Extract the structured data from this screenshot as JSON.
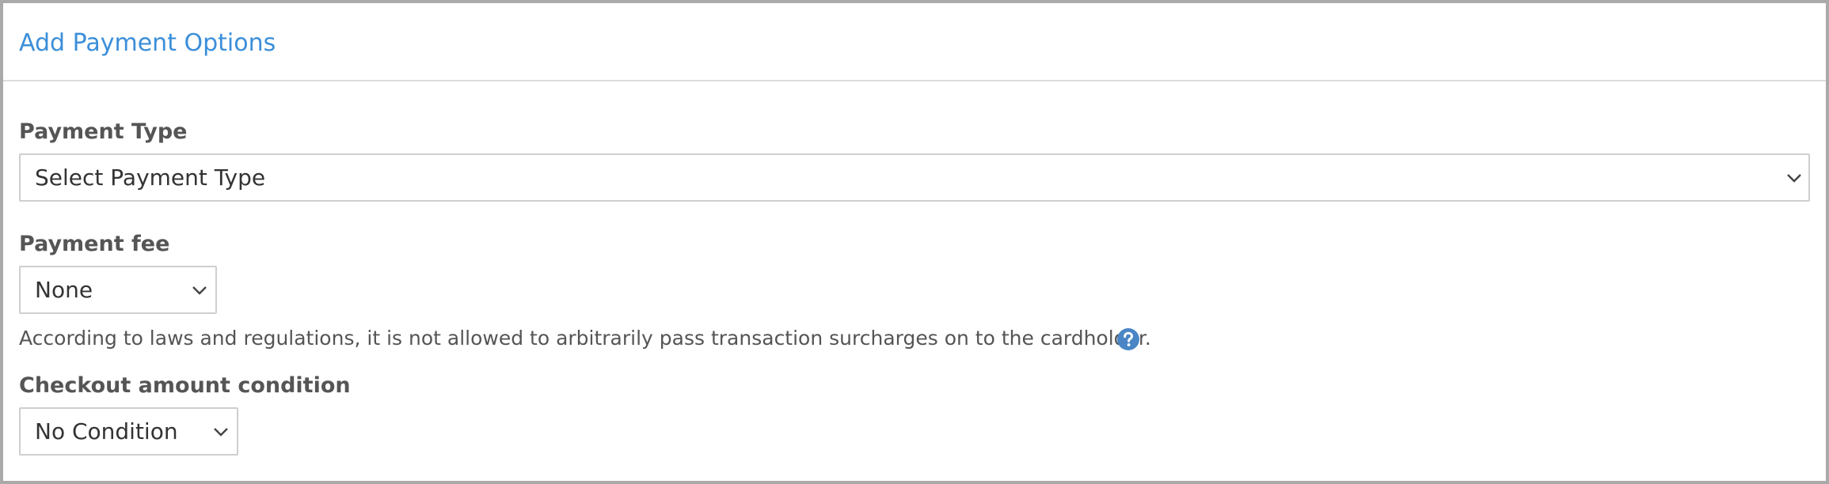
{
  "header": {
    "title": "Add Payment Options"
  },
  "payment_type": {
    "label": "Payment Type",
    "selected": "Select Payment Type"
  },
  "payment_fee": {
    "label": "Payment fee",
    "selected": "None",
    "notice": "According to laws and regulations, it is not allowed to arbitrarily pass transaction surcharges on to the cardholder."
  },
  "checkout_condition": {
    "label": "Checkout amount condition",
    "selected": "No Condition"
  },
  "icons": {
    "help": "question-circle-icon",
    "dropdown": "chevron-down-icon"
  },
  "colors": {
    "title": "#3b8fd9",
    "help_icon": "#4a86c5",
    "label": "#555555",
    "panel_border": "#aaaaaa"
  }
}
